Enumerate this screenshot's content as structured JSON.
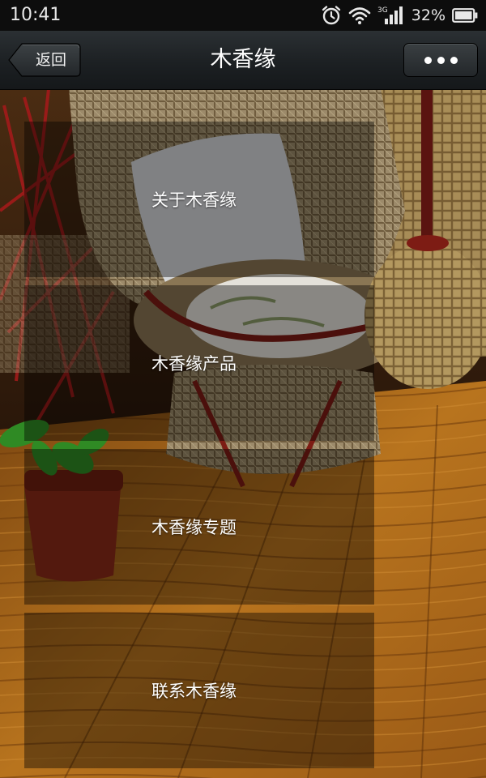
{
  "status_bar": {
    "time": "10:41",
    "network": "3G",
    "battery": "32%",
    "icons": [
      "alarm-icon",
      "wifi-icon",
      "signal-icon",
      "battery-icon"
    ]
  },
  "nav": {
    "back_label": "返回",
    "title": "木香缘",
    "more_icon": "more-dots-icon"
  },
  "menu": {
    "items": [
      {
        "label": "关于木香缘"
      },
      {
        "label": "木香缘产品"
      },
      {
        "label": "木香缘专题"
      },
      {
        "label": "联系木香缘"
      }
    ]
  },
  "colors": {
    "status_bar_bg": "#0d0d0d",
    "nav_bar_bg": "#1c2023",
    "menu_overlay": "rgba(0,0,0,0.40)",
    "text": "#ffffff"
  }
}
